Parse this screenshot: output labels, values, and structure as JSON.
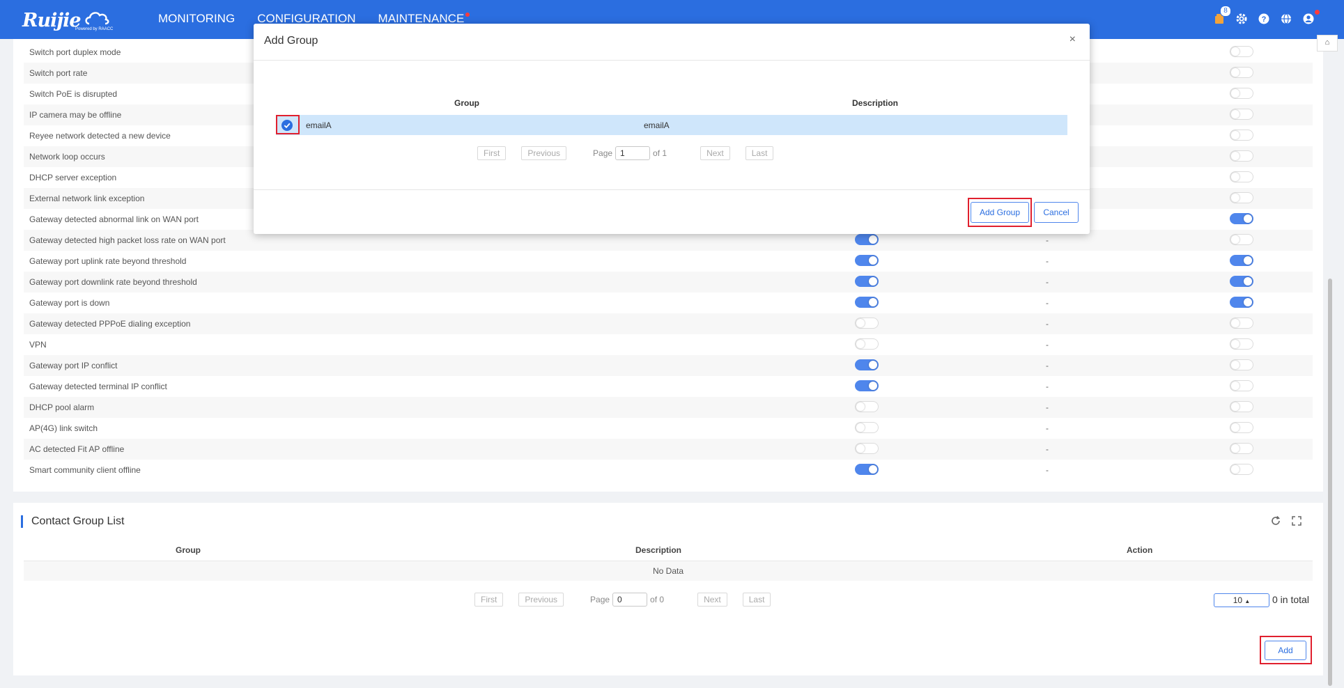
{
  "brand": {
    "logo_text": "Ruijie",
    "logo_sub": "Powered by RAACC"
  },
  "nav": {
    "monitoring": "MONITORING",
    "configuration": "CONFIGURATION",
    "maintenance": "MAINTENANCE"
  },
  "top_icons": {
    "notifications_badge": "8"
  },
  "alarm_rules": [
    {
      "name": "Switch port duplex mode",
      "toggle_a": null,
      "dash": false,
      "toggle_b": false
    },
    {
      "name": "Switch port rate",
      "toggle_a": null,
      "dash": false,
      "toggle_b": false
    },
    {
      "name": "Switch PoE is disrupted",
      "toggle_a": null,
      "dash": false,
      "toggle_b": false
    },
    {
      "name": "IP camera may be offline",
      "toggle_a": null,
      "dash": false,
      "toggle_b": false
    },
    {
      "name": "Reyee network detected a new device",
      "toggle_a": null,
      "dash": false,
      "toggle_b": false
    },
    {
      "name": "Network loop occurs",
      "toggle_a": null,
      "dash": false,
      "toggle_b": false
    },
    {
      "name": "DHCP server exception",
      "toggle_a": null,
      "dash": false,
      "toggle_b": false
    },
    {
      "name": "External network link exception",
      "toggle_a": null,
      "dash": false,
      "toggle_b": false
    },
    {
      "name": "Gateway detected abnormal link on WAN port",
      "toggle_a": null,
      "dash": false,
      "toggle_b": true
    },
    {
      "name": "Gateway detected high packet loss rate on WAN port",
      "toggle_a": true,
      "dash": true,
      "toggle_b": false
    },
    {
      "name": "Gateway port uplink rate beyond threshold",
      "toggle_a": true,
      "dash": true,
      "toggle_b": true
    },
    {
      "name": "Gateway port downlink rate beyond threshold",
      "toggle_a": true,
      "dash": true,
      "toggle_b": true
    },
    {
      "name": "Gateway port is down",
      "toggle_a": true,
      "dash": true,
      "toggle_b": true
    },
    {
      "name": "Gateway detected PPPoE dialing exception",
      "toggle_a": false,
      "dash": true,
      "toggle_b": false
    },
    {
      "name": "VPN",
      "toggle_a": false,
      "dash": true,
      "toggle_b": false
    },
    {
      "name": "Gateway port IP conflict",
      "toggle_a": true,
      "dash": true,
      "toggle_b": false
    },
    {
      "name": "Gateway detected terminal IP conflict",
      "toggle_a": true,
      "dash": true,
      "toggle_b": false
    },
    {
      "name": "DHCP pool alarm",
      "toggle_a": false,
      "dash": true,
      "toggle_b": false
    },
    {
      "name": "AP(4G) link switch",
      "toggle_a": false,
      "dash": true,
      "toggle_b": false
    },
    {
      "name": "AC detected Fit AP offline",
      "toggle_a": false,
      "dash": true,
      "toggle_b": false
    },
    {
      "name": "Smart community client offline",
      "toggle_a": true,
      "dash": true,
      "toggle_b": false
    }
  ],
  "dash_text": "-",
  "contact_group": {
    "title": "Contact Group List",
    "col_group": "Group",
    "col_description": "Description",
    "col_action": "Action",
    "no_data": "No Data",
    "pager": {
      "first": "First",
      "previous": "Previous",
      "page_label": "Page",
      "page_value": "0",
      "of_text": "of 0",
      "next": "Next",
      "last": "Last"
    },
    "page_size": "10",
    "total_text": "0 in total",
    "add_label": "Add"
  },
  "modal": {
    "title": "Add Group",
    "close": "×",
    "col_group": "Group",
    "col_description": "Description",
    "row": {
      "group": "emailA",
      "description": "emailA",
      "checked": true
    },
    "pager": {
      "first": "First",
      "previous": "Previous",
      "page_label": "Page",
      "page_value": "1",
      "of_text": "of 1",
      "next": "Next",
      "last": "Last"
    },
    "add_group_label": "Add Group",
    "cancel_label": "Cancel"
  }
}
